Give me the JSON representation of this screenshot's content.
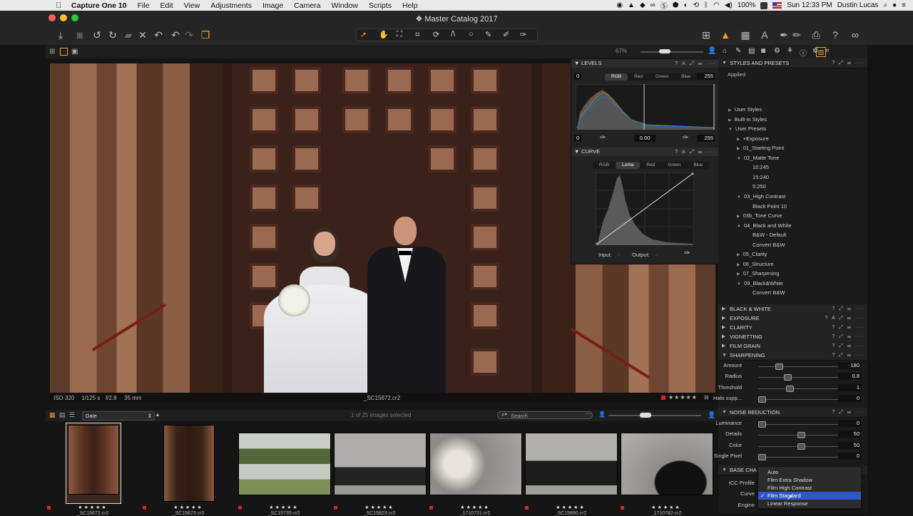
{
  "menubar": {
    "app": "Capture One 10",
    "items": [
      "File",
      "Edit",
      "View",
      "Adjustments",
      "Image",
      "Camera",
      "Window",
      "Scripts",
      "Help"
    ],
    "battery": "100%",
    "clock": "Sun 12:33 PM",
    "user": "Dustin Lucas"
  },
  "window": {
    "title": "Master Catalog 2017"
  },
  "toolbar": {
    "left_icons": [
      "import-icon",
      "camera-icon",
      "rotate-left-icon",
      "rotate-right-icon",
      "folder-icon",
      "delete-icon",
      "undo-icon",
      "undo2-icon",
      "redo-icon",
      "variants-icon"
    ],
    "cursor_tools": [
      "select-cursor-icon",
      "pan-icon",
      "loupe-icon",
      "crop-icon",
      "rotate-tool-icon",
      "keystone-icon",
      "circle-tool-icon",
      "brush-icon",
      "eraser-icon",
      "picker-icon"
    ],
    "right_icons": [
      "grid-icon",
      "warning-icon",
      "focus-icon",
      "text-icon",
      "pen-icon",
      "edit-icon",
      "print-icon",
      "help-icon",
      "glasses-icon"
    ]
  },
  "viewer": {
    "zoom": "67%",
    "iso": "ISO 320",
    "shutter": "1/125 s",
    "aperture": "f/2.8",
    "focal": "35 mm",
    "filename": "_SC15672.cr2",
    "rating": "★★★★★"
  },
  "filmstrip": {
    "sort_label": "Date",
    "selection": "1 of 25 images selected",
    "search_placeholder": "Search",
    "thumbs": [
      {
        "rating": "★★★★★",
        "name": "_SC15672.cr2"
      },
      {
        "rating": "★★★★★",
        "name": "_SC15673.cr2"
      },
      {
        "rating": "★★★★★",
        "name": "_SC15735.cr2"
      },
      {
        "rating": "★★★★★",
        "name": "_SC15823.cr2"
      },
      {
        "rating": "★★★★★",
        "name": "_1710731.cr2"
      },
      {
        "rating": "★★★★★",
        "name": "_SC15890.cr2"
      },
      {
        "rating": "★★★★★",
        "name": "_1710782.cr2"
      }
    ]
  },
  "levels": {
    "title": "LEVELS",
    "tabs": [
      "RGB",
      "Red",
      "Green",
      "Blue"
    ],
    "in_low": "0",
    "in_high": "255",
    "out_low": "0",
    "mid": "0.00",
    "out_high": "255"
  },
  "curve": {
    "title": "CURVE",
    "tabs": [
      "RGB",
      "Luma",
      "Red",
      "Green",
      "Blue"
    ],
    "input_label": "Input:",
    "input_value": "-",
    "output_label": "Output:",
    "output_value": "-"
  },
  "styles": {
    "title": "STYLES AND PRESETS",
    "applied": "Applied",
    "tree": [
      {
        "label": "User Styles",
        "indent": 0,
        "tw": "▶"
      },
      {
        "label": "Built-in Styles",
        "indent": 0,
        "tw": "▶"
      },
      {
        "label": "User Presets",
        "indent": 0,
        "tw": "▼"
      },
      {
        "label": "+Exposure",
        "indent": 1,
        "tw": "▶"
      },
      {
        "label": "01_Starting Point",
        "indent": 1,
        "tw": "▶"
      },
      {
        "label": "02_Matte Tone",
        "indent": 1,
        "tw": "▼"
      },
      {
        "label": "10:245",
        "indent": 2,
        "tw": ""
      },
      {
        "label": "15:240",
        "indent": 2,
        "tw": ""
      },
      {
        "label": "5:250",
        "indent": 2,
        "tw": ""
      },
      {
        "label": "03_High Contrast",
        "indent": 1,
        "tw": "▼"
      },
      {
        "label": "Black Point 10",
        "indent": 2,
        "tw": ""
      },
      {
        "label": "03b_Tone Curve",
        "indent": 1,
        "tw": "▶"
      },
      {
        "label": "04_Black and White",
        "indent": 1,
        "tw": "▼"
      },
      {
        "label": "B&W - Default",
        "indent": 2,
        "tw": ""
      },
      {
        "label": "Convert B&W",
        "indent": 2,
        "tw": ""
      },
      {
        "label": "05_Clarity",
        "indent": 1,
        "tw": "▶"
      },
      {
        "label": "06_Structure",
        "indent": 1,
        "tw": "▶"
      },
      {
        "label": "07_Sharpening",
        "indent": 1,
        "tw": "▶"
      },
      {
        "label": "09_Black&White",
        "indent": 1,
        "tw": "▼"
      },
      {
        "label": "Convert B&W",
        "indent": 2,
        "tw": ""
      }
    ]
  },
  "panels": {
    "bw": "BLACK & WHITE",
    "exposure": "EXPOSURE",
    "clarity": "CLARITY",
    "vignetting": "VIGNETTING",
    "filmgrain": "FILM GRAIN",
    "sharpening": "SHARPENING",
    "noise": "NOISE REDUCTION",
    "base": "BASE CHA"
  },
  "sharpening": [
    {
      "label": "Amount",
      "value": "180",
      "pos": 0.22
    },
    {
      "label": "Radius",
      "value": "0.8",
      "pos": 0.33
    },
    {
      "label": "Threshold",
      "value": "1",
      "pos": 0.35
    },
    {
      "label": "Halo supp...",
      "value": "0",
      "pos": 0.0
    }
  ],
  "noise": [
    {
      "label": "Luminance",
      "value": "0",
      "pos": 0.0
    },
    {
      "label": "Details",
      "value": "50",
      "pos": 0.5
    },
    {
      "label": "Color",
      "value": "50",
      "pos": 0.5
    },
    {
      "label": "Single Pixel",
      "value": "0",
      "pos": 0.0
    }
  ],
  "base": {
    "icc_label": "ICC Profile",
    "curve_label": "Curve",
    "engine_label": "Engine"
  },
  "curve_dropdown": {
    "options": [
      "Auto",
      "Film Extra Shadow",
      "Film High Contrast",
      "Film Standard",
      "Linear Response"
    ],
    "selected": "Film Standard"
  },
  "colors": {
    "accent": "#f0a030",
    "selection": "#2e58c9",
    "redtag": "#dd2222"
  }
}
